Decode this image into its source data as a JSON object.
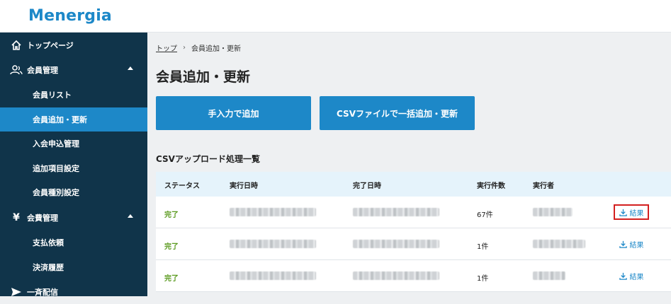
{
  "app": {
    "logo": "Menergia"
  },
  "sidebar": {
    "items": [
      {
        "label": "トップページ",
        "icon": "home-icon"
      },
      {
        "label": "会員管理",
        "icon": "users-icon"
      },
      {
        "label": "会員リスト"
      },
      {
        "label": "会員追加・更新"
      },
      {
        "label": "入会申込管理"
      },
      {
        "label": "追加項目設定"
      },
      {
        "label": "会員種別設定"
      },
      {
        "label": "会費管理",
        "icon": "yen-icon"
      },
      {
        "label": "支払依頼"
      },
      {
        "label": "決済履歴"
      },
      {
        "label": "一斉配信",
        "icon": "send-icon"
      }
    ]
  },
  "breadcrumb": {
    "home": "トップ",
    "separator": "›",
    "current": "会員追加・更新"
  },
  "page": {
    "title": "会員追加・更新"
  },
  "actions": {
    "manual_add": "手入力で追加",
    "csv_add": "CSVファイルで一括追加・更新"
  },
  "section": {
    "title": "CSVアップロード処理一覧"
  },
  "table": {
    "headers": [
      "ステータス",
      "実行日時",
      "完了日時",
      "実行件数",
      "実行者"
    ],
    "rows": [
      {
        "status": "完了",
        "count": "67件",
        "result": "結果"
      },
      {
        "status": "完了",
        "count": "1件",
        "result": "結果"
      },
      {
        "status": "完了",
        "count": "1件",
        "result": "結果"
      }
    ]
  },
  "colors": {
    "accent": "#1d88c8",
    "sidebar": "#10344a",
    "status_done": "#5a9a1f",
    "highlight": "#d32020"
  }
}
